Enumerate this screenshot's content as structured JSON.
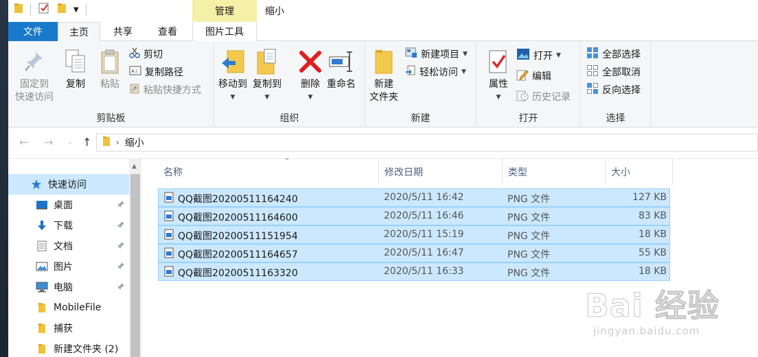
{
  "title_bar": {
    "manage_tab": "管理",
    "window_title": "缩小"
  },
  "tabs": {
    "file": "文件",
    "home": "主页",
    "share": "共享",
    "view": "查看",
    "picture_tools": "图片工具"
  },
  "ribbon": {
    "clipboard": {
      "title": "剪贴板",
      "pin_line1": "固定到",
      "pin_line2": "快速访问",
      "copy": "复制",
      "paste": "粘贴",
      "cut": "剪切",
      "copy_path": "复制路径",
      "paste_shortcut": "粘贴快捷方式"
    },
    "organize": {
      "title": "组织",
      "move_to": "移动到",
      "copy_to": "复制到",
      "delete": "删除",
      "rename": "重命名"
    },
    "new": {
      "title": "新建",
      "new_folder_line1": "新建",
      "new_folder_line2": "文件夹",
      "new_item": "新建项目",
      "easy_access": "轻松访问"
    },
    "open": {
      "title": "打开",
      "properties": "属性",
      "open": "打开",
      "edit": "编辑",
      "history": "历史记录"
    },
    "select": {
      "title": "选择",
      "select_all": "全部选择",
      "select_none": "全部取消",
      "invert": "反向选择"
    }
  },
  "address": {
    "path": "缩小"
  },
  "nav": {
    "quick_access": "快速访问",
    "items": [
      {
        "label": "桌面"
      },
      {
        "label": "下载"
      },
      {
        "label": "文档"
      },
      {
        "label": "图片"
      },
      {
        "label": "电脑"
      },
      {
        "label": "MobileFile"
      },
      {
        "label": "捕获"
      },
      {
        "label": "新建文件夹 (2)"
      }
    ]
  },
  "columns": {
    "name": "名称",
    "date": "修改日期",
    "type": "类型",
    "size": "大小"
  },
  "files": [
    {
      "name": "QQ截图20200511164240",
      "date": "2020/5/11 16:42",
      "type": "PNG 文件",
      "size": "127 KB"
    },
    {
      "name": "QQ截图20200511164600",
      "date": "2020/5/11 16:46",
      "type": "PNG 文件",
      "size": "83 KB"
    },
    {
      "name": "QQ截图20200511151954",
      "date": "2020/5/11 15:19",
      "type": "PNG 文件",
      "size": "18 KB"
    },
    {
      "name": "QQ截图20200511164657",
      "date": "2020/5/11 16:47",
      "type": "PNG 文件",
      "size": "55 KB"
    },
    {
      "name": "QQ截图20200511163320",
      "date": "2020/5/11 16:33",
      "type": "PNG 文件",
      "size": "18 KB"
    }
  ],
  "watermark": {
    "logo": "Bai 经验",
    "url": "jingyan.baidu.com"
  },
  "colors": {
    "file_tab": "#1979ca",
    "manage_tab": "#f4f0a7",
    "selection": "#cce8ff",
    "selection_border": "#99d1ff",
    "ribbon_bg": "#f5f6f7"
  }
}
